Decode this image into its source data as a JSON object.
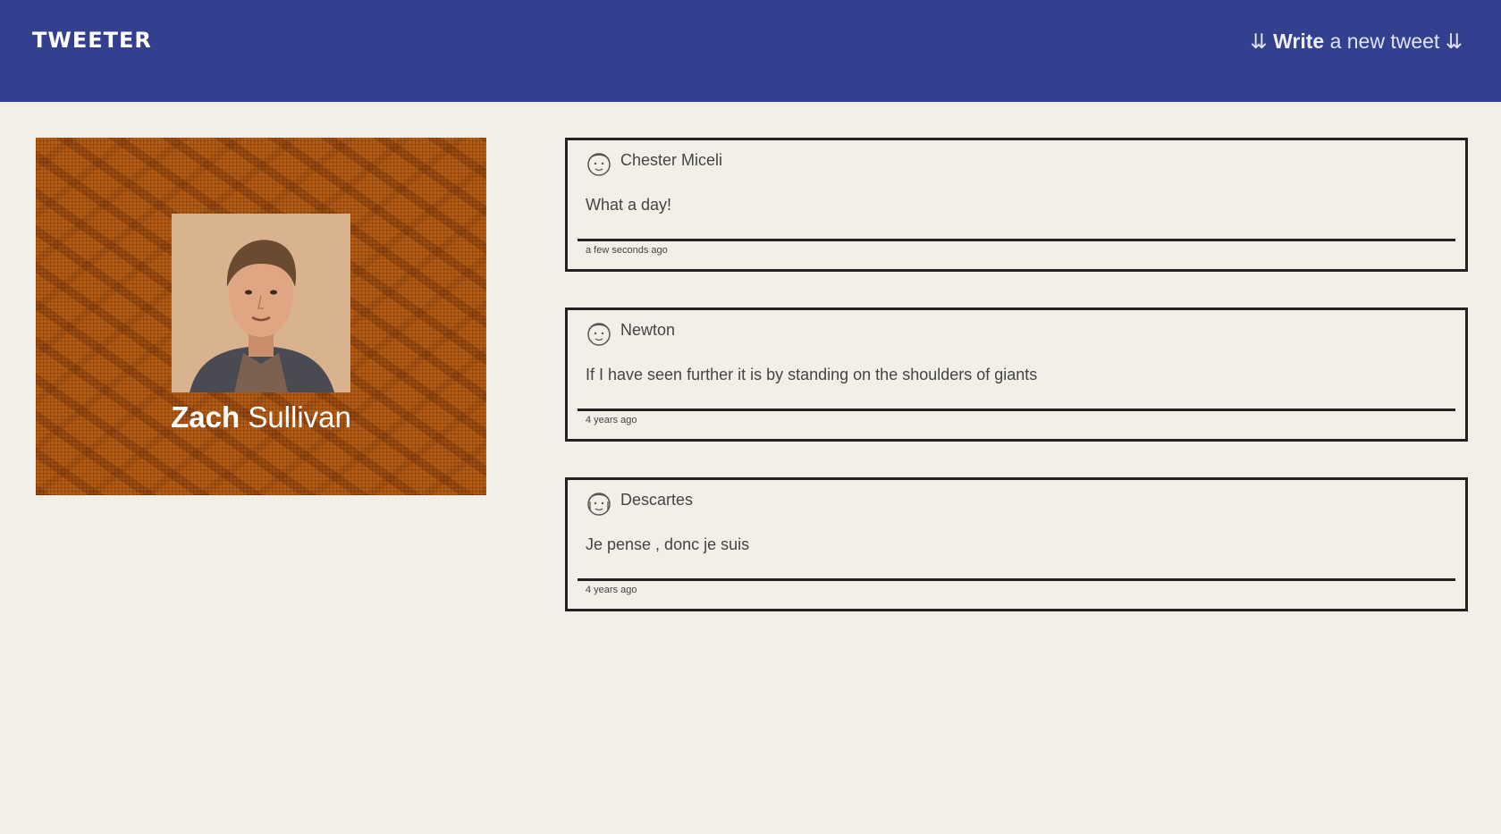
{
  "nav": {
    "logo": "TWEETER",
    "compose_arrows_left": "⇊",
    "compose_bold": "Write",
    "compose_rest": " a new tweet ",
    "compose_arrows_right": "⇊"
  },
  "profile": {
    "first_name": "Zach",
    "last_name": "Sullivan",
    "background_color": "#b85a10"
  },
  "tweets": [
    {
      "author": "Chester Miceli",
      "content": "What a day!",
      "time": "a few seconds ago",
      "avatar_icon": "face-icon"
    },
    {
      "author": "Newton",
      "content": "If I have seen further it is by standing on the shoulders of giants",
      "time": "4 years ago",
      "avatar_icon": "face-icon"
    },
    {
      "author": "Descartes",
      "content": "Je pense , donc je suis",
      "time": "4 years ago",
      "avatar_icon": "face-icon"
    }
  ],
  "colors": {
    "nav_bg": "#333f8f",
    "page_bg": "#f2efe8",
    "border": "#222222"
  }
}
